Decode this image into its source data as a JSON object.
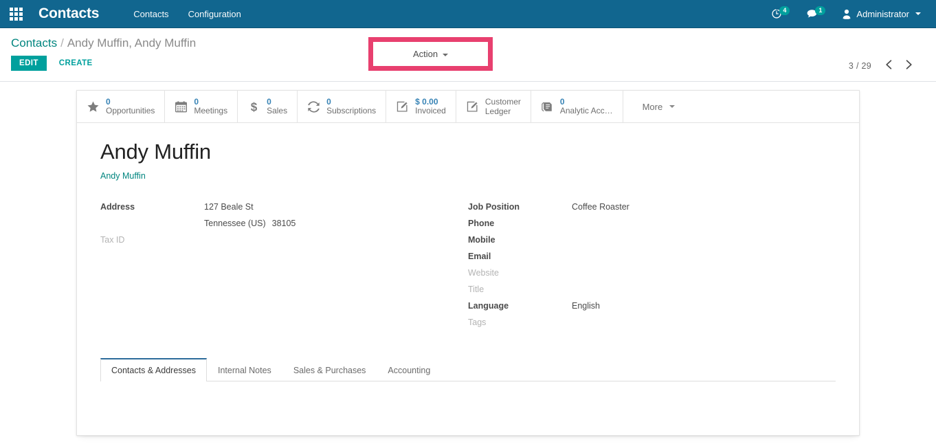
{
  "navbar": {
    "apps_icon": "apps-grid-icon",
    "brand": "Contacts",
    "menu": [
      {
        "label": "Contacts"
      },
      {
        "label": "Configuration"
      }
    ],
    "systray": {
      "activity": {
        "icon": "clock-activity-icon",
        "count": "4"
      },
      "messaging": {
        "icon": "chat-bubble-icon",
        "count": "1"
      },
      "user": {
        "icon": "user-avatar-icon",
        "name": "Administrator"
      }
    },
    "colors": {
      "background": "#11668f",
      "badge": "#00a09d"
    }
  },
  "control_panel": {
    "breadcrumb": {
      "root": "Contacts",
      "separator": "/",
      "current": "Andy Muffin, Andy Muffin"
    },
    "edit_label": "EDIT",
    "create_label": "CREATE",
    "action_label": "Action",
    "action_highlight_color": "#e8406f",
    "pager": {
      "counter": "3 / 29",
      "prev_icon": "chevron-left-icon",
      "next_icon": "chevron-right-icon"
    },
    "colors": {
      "primary": "#00a09d",
      "link": "#00857f"
    }
  },
  "stat_buttons": [
    {
      "icon": "star-icon",
      "value": "0",
      "label": "Opportunities"
    },
    {
      "icon": "calendar-icon",
      "value": "0",
      "label": "Meetings"
    },
    {
      "icon": "dollar-icon",
      "value": "0",
      "label": "Sales"
    },
    {
      "icon": "refresh-icon",
      "value": "0",
      "label": "Subscriptions"
    },
    {
      "icon": "pencil-square-icon",
      "value": "$ 0.00",
      "label": "Invoiced"
    },
    {
      "icon": "pencil-square-icon",
      "value": "",
      "label_line1": "Customer",
      "label_line2": "Ledger"
    },
    {
      "icon": "book-icon",
      "value": "0",
      "label": "Analytic Acc…"
    }
  ],
  "stat_more": {
    "label": "More",
    "icon": "caret-down-icon"
  },
  "record": {
    "title": "Andy Muffin",
    "parent_link": "Andy Muffin",
    "left_fields": {
      "address_label": "Address",
      "address_street": "127 Beale St",
      "address_state": "Tennessee (US)",
      "address_zip": "38105",
      "tax_id_label": "Tax ID",
      "tax_id_value": ""
    },
    "right_fields": [
      {
        "label": "Job Position",
        "value": "Coffee Roaster",
        "muted": false
      },
      {
        "label": "Phone",
        "value": "",
        "muted": false
      },
      {
        "label": "Mobile",
        "value": "",
        "muted": false
      },
      {
        "label": "Email",
        "value": "",
        "muted": false
      },
      {
        "label": "Website",
        "value": "",
        "muted": true
      },
      {
        "label": "Title",
        "value": "",
        "muted": true
      },
      {
        "label": "Language",
        "value": "English",
        "muted": false
      },
      {
        "label": "Tags",
        "value": "",
        "muted": true
      }
    ]
  },
  "notebook": {
    "tabs": [
      {
        "label": "Contacts & Addresses",
        "active": true
      },
      {
        "label": "Internal Notes",
        "active": false
      },
      {
        "label": "Sales & Purchases",
        "active": false
      },
      {
        "label": "Accounting",
        "active": false
      }
    ],
    "active_tab_border_color": "#2c6b9b"
  }
}
